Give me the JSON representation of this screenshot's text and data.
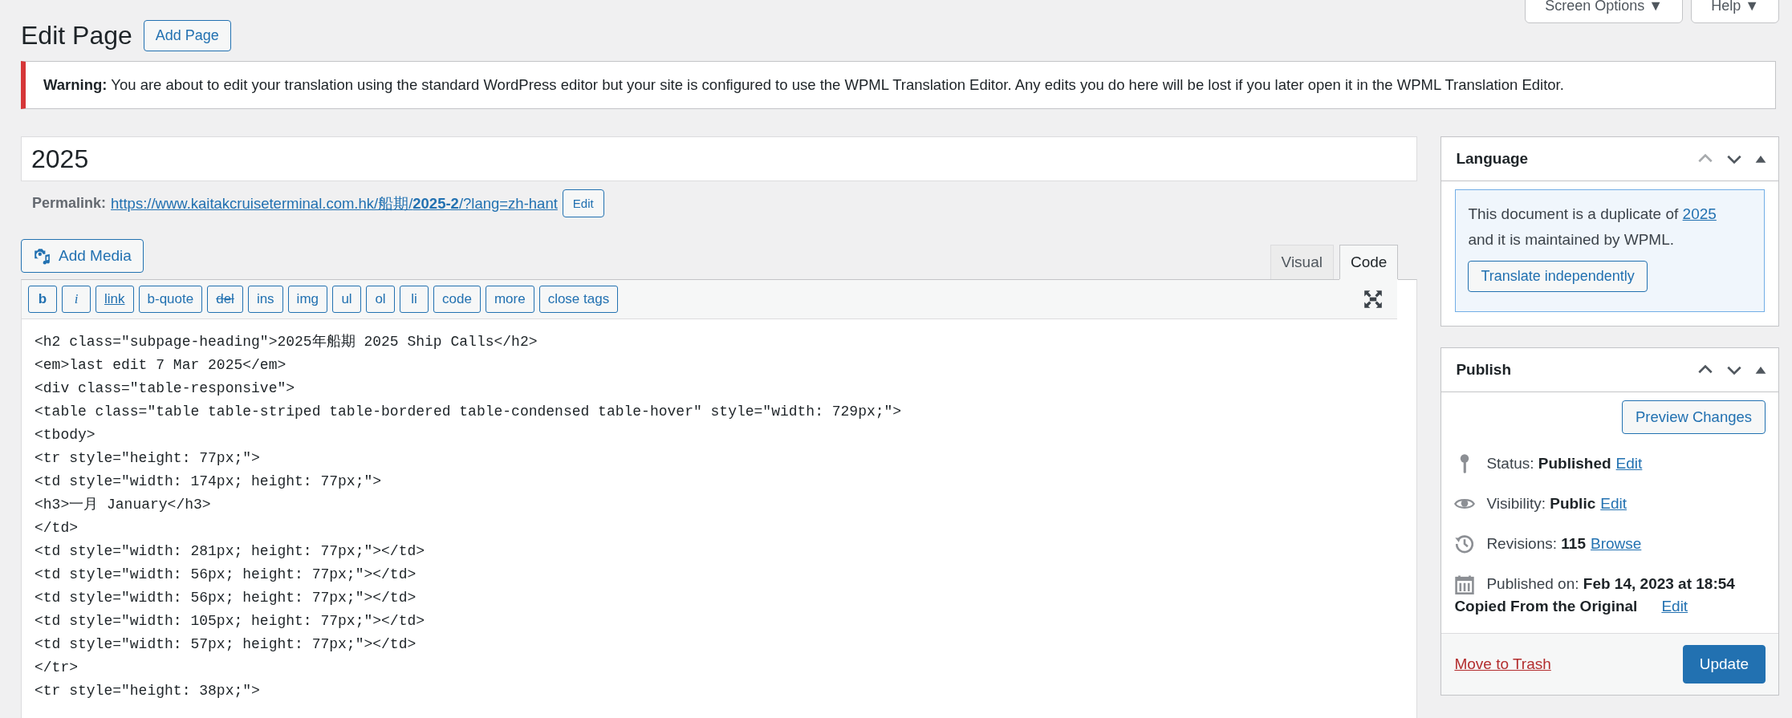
{
  "header": {
    "title": "Edit Page",
    "add_button": "Add Page"
  },
  "top_buttons": [
    {
      "label": "Screen Options",
      "caret": "▼"
    },
    {
      "label": "Help",
      "caret": "▼"
    }
  ],
  "notice": {
    "text": "**Warning:** You are about to edit your translation using the standard WordPress editor but your site is configured to use the WPML Translation Editor. Any edits you do here will be lost if you later open it in the WPML Translation Editor."
  },
  "post_title": {
    "value": "2025"
  },
  "permalink": {
    "label": "Permalink:",
    "url": "https://www.kaitakcruiseterminal.com.hk/船期/**2025-2**/?lang=zh-hant",
    "edit_button": "Edit"
  },
  "add_media": "Add Media",
  "editor_tabs": [
    {
      "label": "Visual",
      "selected": false
    },
    {
      "label": "Code",
      "selected": true
    }
  ],
  "quicktags": [
    {
      "label": "b",
      "kind": "bold"
    },
    {
      "label": "i",
      "kind": "italic"
    },
    {
      "label": "link",
      "kind": "underline"
    },
    {
      "label": "b-quote",
      "kind": "plain"
    },
    {
      "label": "del",
      "kind": "strike"
    },
    {
      "label": "ins",
      "kind": "plain"
    },
    {
      "label": "img",
      "kind": "plain"
    },
    {
      "label": "ul",
      "kind": "plain"
    },
    {
      "label": "ol",
      "kind": "plain"
    },
    {
      "label": "li",
      "kind": "plain"
    },
    {
      "label": "code",
      "kind": "plain"
    },
    {
      "label": "more",
      "kind": "plain"
    },
    {
      "label": "close tags",
      "kind": "plain"
    }
  ],
  "code_lines": [
    "<h2 class=\"subpage-heading\">2025年船期 2025 Ship Calls</h2>",
    "<em>last edit 7 Mar 2025</em>",
    "<div class=\"table-responsive\">",
    "<table class=\"table table-striped table-bordered table-condensed table-hover\" style=\"width: 729px;\">",
    "<tbody>",
    "<tr style=\"height: 77px;\">",
    "<td style=\"width: 174px; height: 77px;\">",
    "<h3>一月 January</h3>",
    "</td>",
    "<td style=\"width: 281px; height: 77px;\"></td>",
    "<td style=\"width: 56px; height: 77px;\"></td>",
    "<td style=\"width: 56px; height: 77px;\"></td>",
    "<td style=\"width: 105px; height: 77px;\"></td>",
    "<td style=\"width: 57px; height: 77px;\"></td>",
    "</tr>",
    "<tr style=\"height: 38px;\">"
  ],
  "language_box": {
    "title": "Language",
    "controls": [
      {
        "kind": "up",
        "disabled": true
      },
      {
        "kind": "down",
        "disabled": false
      },
      {
        "kind": "toggle",
        "disabled": false
      }
    ],
    "notice_before": "This document is a duplicate of",
    "notice_link": "2025",
    "notice_after": "and it is maintained by WPML.",
    "button": "Translate independently"
  },
  "publish_box": {
    "title": "Publish",
    "controls": [
      {
        "kind": "up",
        "disabled": false
      },
      {
        "kind": "down",
        "disabled": false
      },
      {
        "kind": "toggle",
        "disabled": false
      }
    ],
    "preview_button": "Preview Changes",
    "rows": [
      {
        "kind": "status",
        "label": "Status:",
        "value": "Published",
        "link": "Edit"
      },
      {
        "kind": "visibility",
        "label": "Visibility:",
        "value": "Public",
        "link": "Edit"
      },
      {
        "kind": "revisions",
        "label": "Revisions:",
        "value": "115",
        "link": "Browse"
      },
      {
        "kind": "date",
        "label": "Published on:",
        "value": "Feb 14, 2023 at 18:54",
        "note": "Copied From the Original",
        "link": "Edit"
      }
    ],
    "trash_link": "Move to Trash",
    "update_button": "Update"
  }
}
